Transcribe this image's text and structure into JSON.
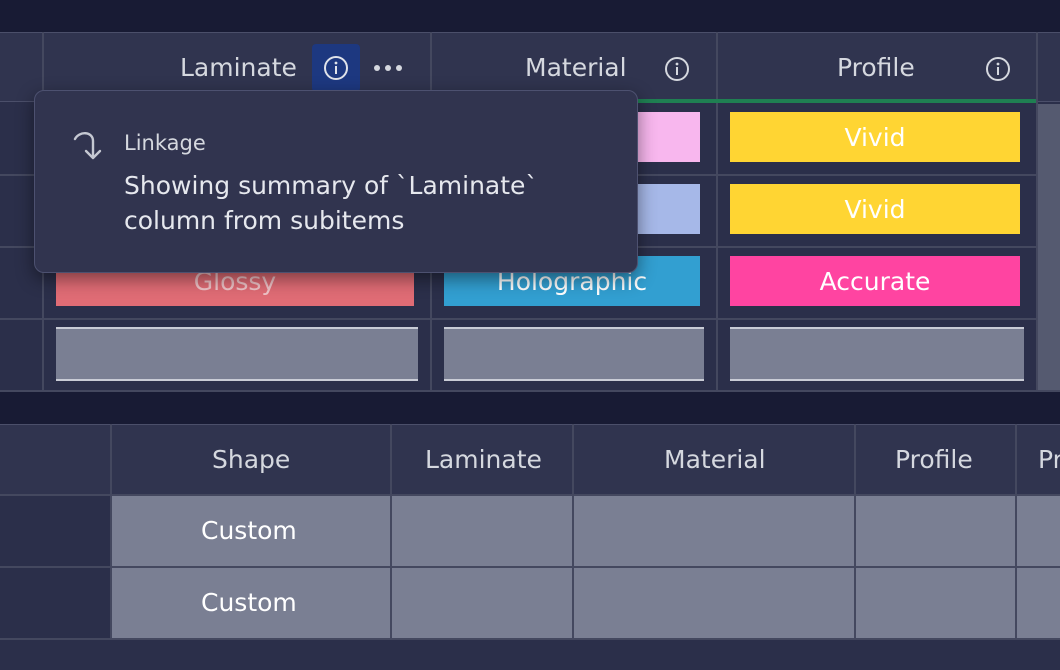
{
  "top_table": {
    "columns": [
      {
        "title": "Laminate"
      },
      {
        "title": "Material"
      },
      {
        "title": "Profile"
      }
    ],
    "rows": [
      {
        "laminate": "",
        "material": "",
        "profile": "Vivid"
      },
      {
        "laminate": "",
        "material": "",
        "profile": "Vivid"
      },
      {
        "laminate": "Glossy",
        "material": "Holographic",
        "profile": "Accurate"
      }
    ]
  },
  "tooltip": {
    "label": "Linkage",
    "line1": "Showing summary of `Laminate`",
    "line2": "column from subitems"
  },
  "subitems_table": {
    "columns": [
      "Shape",
      "Laminate",
      "Material",
      "Profile",
      "Pr"
    ],
    "rows": [
      {
        "shape": "Custom"
      },
      {
        "shape": "Custom"
      }
    ]
  },
  "colors": {
    "vivid": "#ffd533",
    "accurate": "#ff44a1",
    "glossy": "#e06c75",
    "holographic": "#329fd1",
    "pink": "#f8b7ee",
    "periwinkle": "#a6b8e8",
    "group_accent": "#1f7f52"
  }
}
